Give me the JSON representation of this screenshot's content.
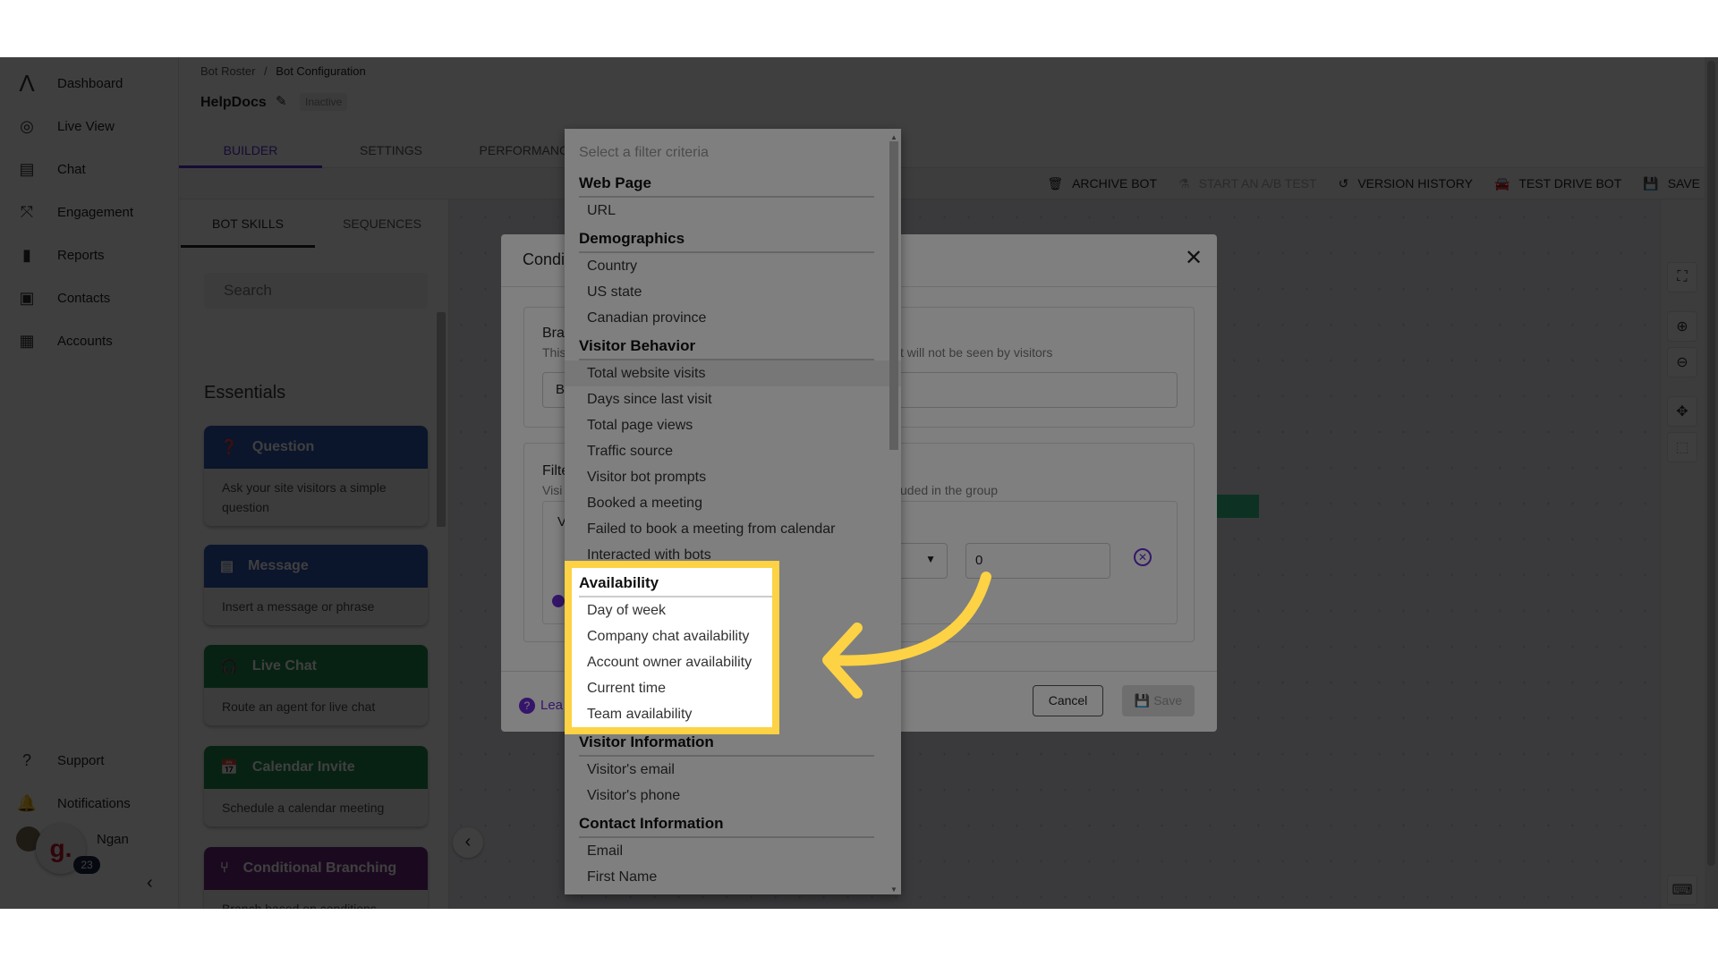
{
  "sidebar": {
    "items": [
      {
        "label": "Dashboard",
        "icon": "logo-icon"
      },
      {
        "label": "Live View",
        "icon": "live-view-icon"
      },
      {
        "label": "Chat",
        "icon": "chat-icon"
      },
      {
        "label": "Engagement",
        "icon": "engagement-icon"
      },
      {
        "label": "Reports",
        "icon": "reports-icon"
      },
      {
        "label": "Contacts",
        "icon": "contacts-icon"
      },
      {
        "label": "Accounts",
        "icon": "accounts-icon"
      }
    ],
    "bottom": [
      {
        "label": "Support",
        "icon": "help-icon"
      },
      {
        "label": "Notifications",
        "icon": "bell-icon"
      }
    ],
    "user": {
      "name": "Ngan",
      "badge_letter": "g.",
      "badge_count": "23"
    }
  },
  "header": {
    "breadcrumb": [
      "Bot Roster",
      "Bot Configuration"
    ],
    "title": "HelpDocs",
    "status": "Inactive",
    "tabs": [
      "BUILDER",
      "SETTINGS",
      "PERFORMANCE"
    ]
  },
  "toolbar": {
    "archive": "ARCHIVE BOT",
    "ab_test": "START AN A/B TEST",
    "history": "VERSION HISTORY",
    "test_drive": "TEST DRIVE BOT",
    "save": "SAVE"
  },
  "panel": {
    "tabs": [
      "BOT SKILLS",
      "SEQUENCES"
    ],
    "search_placeholder": "Search",
    "section": "Essentials",
    "cards": [
      {
        "title": "Question",
        "desc": "Ask your site visitors a simple question",
        "color": "#2f56b0"
      },
      {
        "title": "Message",
        "desc": "Insert a message or phrase",
        "color": "#2f56b0"
      },
      {
        "title": "Live Chat",
        "desc": "Route an agent for live chat",
        "color": "#1f8a4f"
      },
      {
        "title": "Calendar Invite",
        "desc": "Schedule a calendar meeting",
        "color": "#1f8a4f"
      },
      {
        "title": "Conditional Branching",
        "desc": "Branch based on conditions",
        "color": "#6e2a7e"
      }
    ]
  },
  "modal": {
    "title": "Condi",
    "s1_title": "Bra",
    "s1_desc_left": "This",
    "s1_desc_right": "t will not be seen by visitors",
    "s1_input": "Bı",
    "s2_title": "Filte",
    "s2_desc_left": "Visi",
    "s2_desc_right": "uded in the group",
    "row_label": "V",
    "value": "0",
    "learn": "Lea",
    "cancel": "Cancel",
    "save": "Save"
  },
  "dropdown": {
    "placeholder": "Select a filter criteria",
    "hover_item": "Total website visits",
    "groups": [
      {
        "header": "Web Page",
        "items": [
          "URL"
        ]
      },
      {
        "header": "Demographics",
        "items": [
          "Country",
          "US state",
          "Canadian province"
        ]
      },
      {
        "header": "Visitor Behavior",
        "items": [
          "Total website visits",
          "Days since last visit",
          "Total page views",
          "Traffic source",
          "Visitor bot prompts",
          "Booked a meeting",
          "Failed to book a meeting from calendar",
          "Interacted with bots"
        ]
      },
      {
        "header": "Availability",
        "highlighted": true,
        "items": [
          "Day of week",
          "Company chat availability",
          "Account owner availability",
          "Current time",
          "Team availability"
        ]
      },
      {
        "header": "Visitor Information",
        "items": [
          "Visitor's email",
          "Visitor's phone"
        ]
      },
      {
        "header": "Contact Information",
        "items": [
          "Email",
          "First Name"
        ]
      }
    ]
  },
  "colors": {
    "accent": "#5b2bd6",
    "highlight": "#fdd244"
  }
}
